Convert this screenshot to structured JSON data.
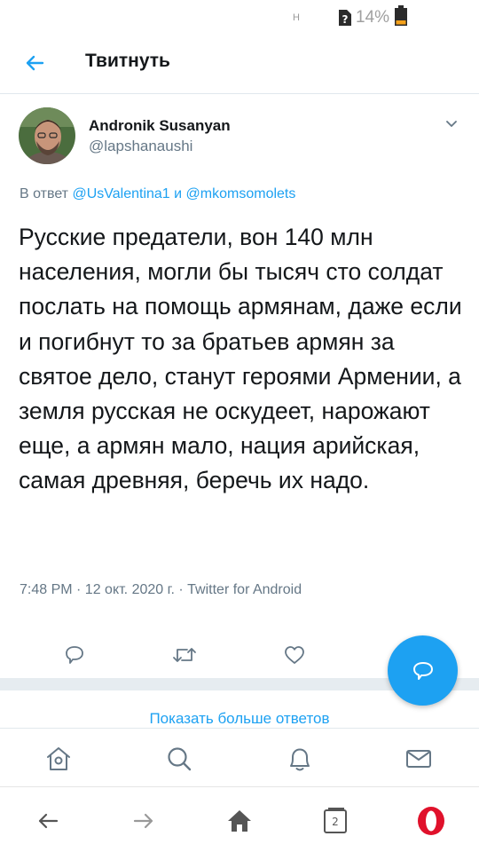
{
  "status_bar": {
    "network_indicator": "H",
    "battery_percent": "14%",
    "icons": [
      "sim-unknown-icon",
      "battery-low-icon"
    ]
  },
  "header": {
    "title": "Твитнуть",
    "back_icon": "arrow-left-icon"
  },
  "tweet": {
    "author_name": "Andronik Susanyan",
    "author_handle": "@lapshanaushi",
    "reply_prefix": "В ответ",
    "reply_mention_1": "@UsValentina1",
    "reply_conjunction": "и",
    "reply_mention_2": "@mkomsomolets",
    "text": "Русские предатели, вон 140 млн населения, могли бы тысяч сто солдат послать на помощь армянам, даже если и погибнут то за братьев армян за святое дело, станут героями Армении, а земля русская не оскудеет, нарожают еще, а армян мало, нация арийская, самая древняя, беречь их надо.",
    "meta": "7:48 PM · 12 окт. 2020 г. · Twitter for Android"
  },
  "actions": [
    "reply-icon",
    "retweet-icon",
    "like-icon",
    "share-icon"
  ],
  "fab_icon": "compose-reply-icon",
  "show_more_replies": "Показать больше ответов",
  "bottom_tabs": [
    "home-icon",
    "search-icon",
    "notifications-icon",
    "messages-icon"
  ],
  "browser_bar": {
    "open_tabs": "2",
    "icons": [
      "back-arrow-icon",
      "forward-arrow-icon",
      "home-icon",
      "tabs-icon",
      "opera-icon"
    ]
  },
  "colors": {
    "accent": "#1da1f2",
    "secondary_text": "#657786",
    "primary_text": "#14171a",
    "divider": "#e6ecf0",
    "opera_red": "#e0112b"
  }
}
